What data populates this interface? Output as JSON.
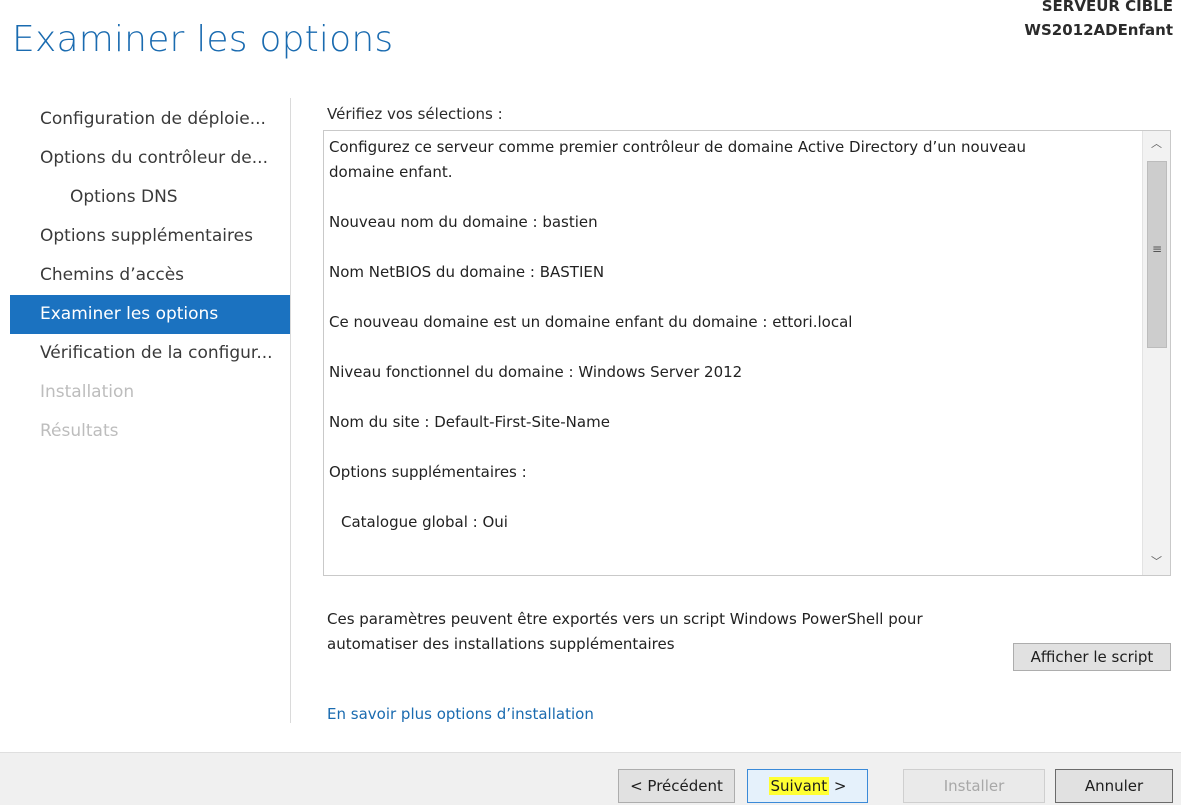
{
  "header": {
    "title": "Examiner les options",
    "target_label": "SERVEUR CIBLE",
    "target_name": "WS2012ADEnfant"
  },
  "nav": {
    "items": [
      {
        "label": "Configuration de déploie...",
        "state": "normal"
      },
      {
        "label": "Options du contrôleur de...",
        "state": "normal"
      },
      {
        "label": "Options DNS",
        "state": "normal",
        "indent": true
      },
      {
        "label": "Options supplémentaires",
        "state": "normal"
      },
      {
        "label": "Chemins d’accès",
        "state": "normal"
      },
      {
        "label": "Examiner les options",
        "state": "active"
      },
      {
        "label": "Vérification de la configur...",
        "state": "normal"
      },
      {
        "label": "Installation",
        "state": "disabled"
      },
      {
        "label": "Résultats",
        "state": "disabled"
      }
    ]
  },
  "review": {
    "label": "Vérifiez vos sélections :",
    "line1a": "Configurez ce serveur comme premier contrôleur de domaine Active Directory d’un nouveau",
    "line1b": "domaine enfant.",
    "domain_name": "Nouveau nom du domaine : bastien",
    "netbios": "Nom NetBIOS du domaine : BASTIEN",
    "parent": "Ce nouveau domaine est un domaine enfant du domaine : ettori.local",
    "functional_level": "Niveau fonctionnel du domaine : Windows Server 2012",
    "site": "Nom du site : Default-First-Site-Name",
    "additional": "Options supplémentaires :",
    "global_catalog": "Catalogue global : Oui"
  },
  "export": {
    "line1": "Ces paramètres peuvent être exportés vers un script Windows PowerShell pour",
    "line2": "automatiser des installations supplémentaires",
    "button": "Afficher le script"
  },
  "learn_more": "En savoir plus options d’installation",
  "footer": {
    "prev": "< Précédent",
    "next_word": "Suivant",
    "next_arrow": " >",
    "install": "Installer",
    "cancel": "Annuler"
  },
  "colors": {
    "accent": "#1b72c0",
    "title": "#1a6bb0",
    "highlight": "#ffff33"
  }
}
